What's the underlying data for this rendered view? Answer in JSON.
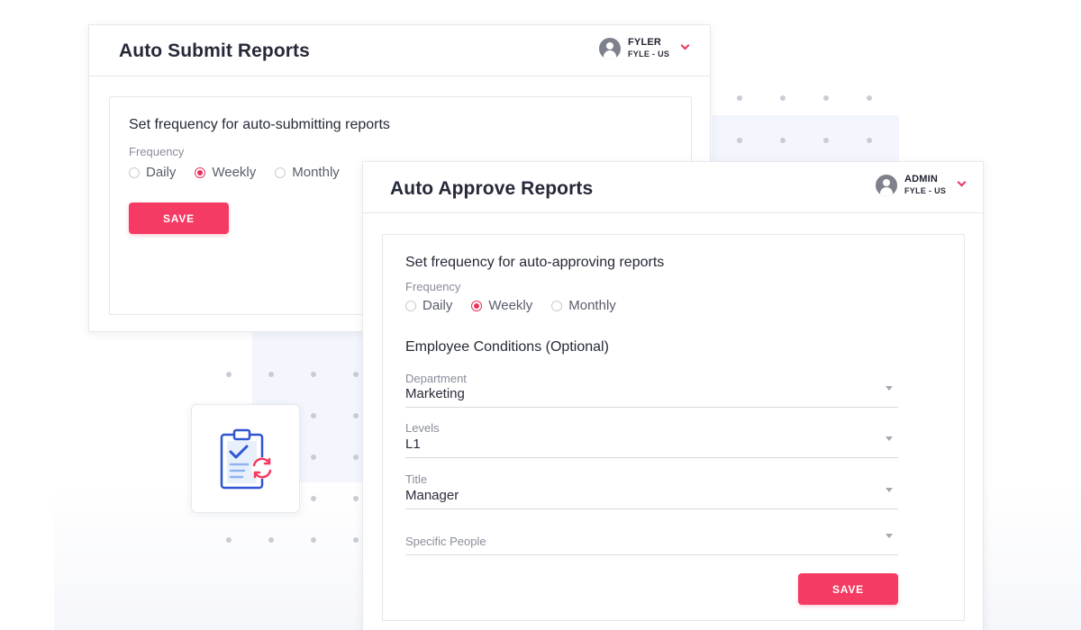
{
  "submit_card": {
    "title": "Auto Submit Reports",
    "user": {
      "name": "FYLER",
      "org": "FYLE - US"
    },
    "section_title": "Set frequency for auto-submitting reports",
    "frequency_label": "Frequency",
    "options": [
      "Daily",
      "Weekly",
      "Monthly"
    ],
    "selected": "Weekly",
    "save_label": "SAVE"
  },
  "approve_card": {
    "title": "Auto Approve Reports",
    "user": {
      "name": "ADMIN",
      "org": "FYLE - US"
    },
    "section_title": "Set frequency for auto-approving reports",
    "frequency_label": "Frequency",
    "options": [
      "Daily",
      "Weekly",
      "Monthly"
    ],
    "selected": "Weekly",
    "conditions_title": "Employee Conditions (Optional)",
    "fields": [
      {
        "label": "Department",
        "value": "Marketing"
      },
      {
        "label": "Levels",
        "value": "L1"
      },
      {
        "label": "Title",
        "value": "Manager"
      },
      {
        "label": "Specific People",
        "value": ""
      }
    ],
    "save_label": "SAVE"
  },
  "icons": {
    "tile_icon": "clipboard-sync-icon",
    "avatar_icon": "user-avatar-icon",
    "dropdown_icon": "chevron-down-icon"
  },
  "colors": {
    "accent": "#f53b63",
    "radio_checked": "#e8335d",
    "title_text": "#262938",
    "muted_text": "#8a8d9a",
    "icon_blue": "#2f55d4",
    "icon_light_blue": "#8fb3f0"
  }
}
